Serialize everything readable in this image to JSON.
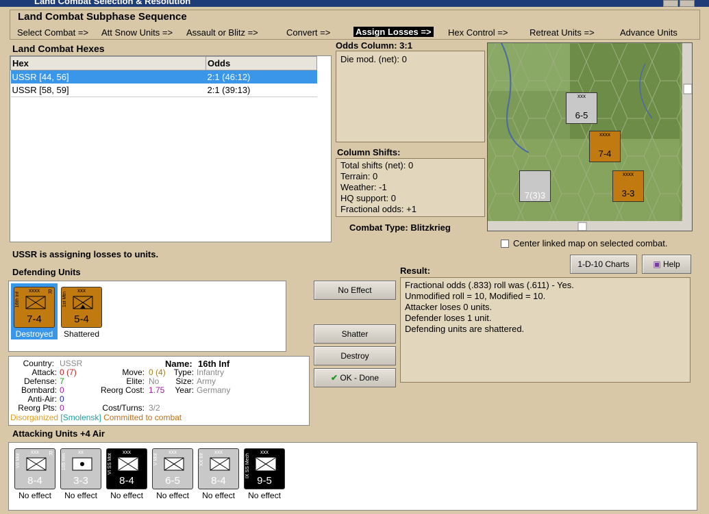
{
  "window": {
    "title": "Land Combat Selection & Resolution"
  },
  "sequence": {
    "title": "Land Combat Subphase Sequence",
    "steps": [
      "Select Combat =>",
      "Att Snow Units =>",
      "Assault or Blitz =>",
      "Convert =>",
      "Assign Losses =>",
      "Hex Control =>",
      "Retreat Units =>",
      "Advance Units"
    ],
    "active_index": 4
  },
  "hexes": {
    "title": "Land Combat Hexes",
    "columns": [
      "Hex",
      "Odds"
    ],
    "rows": [
      {
        "hex": "USSR [44, 56]",
        "odds": "2:1 (46:12)"
      },
      {
        "hex": "USSR [58, 59]",
        "odds": "2:1 (39:13)"
      }
    ],
    "selected_row": 0
  },
  "odds": {
    "title": "Odds Column: 3:1",
    "die_mod": "Die mod. (net): 0"
  },
  "shifts": {
    "title": "Column Shifts:",
    "lines": [
      "Total shifts (net): 0",
      "Terrain: 0",
      "Weather: -1",
      "HQ support: 0",
      "Fractional odds: +1"
    ]
  },
  "combat_type": "Combat Type:  Blitzkrieg",
  "center_map": {
    "label": "Center linked map on selected combat.",
    "checked": false
  },
  "buttons": {
    "charts": "1-D-10 Charts",
    "help": "Help",
    "no_effect": "No Effect",
    "shatter": "Shatter",
    "destroy": "Destroy",
    "ok": "OK - Done"
  },
  "status": "USSR is assigning losses to units.",
  "defending": {
    "title": "Defending Units",
    "units": [
      {
        "side": "16th Inf",
        "size": "xxxx",
        "factors": "7-4",
        "caption": "Destroyed",
        "selected": true,
        "corner": "R"
      },
      {
        "side": "1st Mtn",
        "size": "xxx",
        "factors": "5-4",
        "caption": "Shattered",
        "selected": false,
        "corner": ""
      }
    ]
  },
  "result": {
    "title": "Result:",
    "lines": [
      "Fractional odds (.833) roll was (.611)  - Yes.",
      "Unmodified roll = 10, Modified = 10.",
      "Attacker loses 0 units.",
      "Defender loses 1 unit.",
      "Defending units are shattered."
    ]
  },
  "details": {
    "country_label": "Country:",
    "country": "USSR",
    "attack_label": "Attack:",
    "attack": "0",
    "attack_paren": "(7)",
    "defense_label": "Defense:",
    "defense": "7",
    "bombard_label": "Bombard:",
    "bombard": "0",
    "antiair_label": "Anti-Air:",
    "antiair": "0",
    "reorg_label": "Reorg Pts:",
    "reorg": "0",
    "name_label": "Name:",
    "name": "16th Inf",
    "move_label": "Move:",
    "move": "0",
    "move_paren": "(4)",
    "type_label": "Type:",
    "type": "Infantry",
    "elite_label": "Elite:",
    "elite": "No",
    "size_label": "Size:",
    "size": "Army",
    "reorgcost_label": "Reorg Cost:",
    "reorgcost": "1.75",
    "year_label": "Year:",
    "year": "Germany",
    "costturns_label": "Cost/Turns:",
    "costturns": "3/2",
    "status_disorg": "Disorganized",
    "status_loc": "[Smolensk]",
    "status_commit": "Committed to combat"
  },
  "attacking": {
    "title": "Attacking Units +4 Air",
    "units": [
      {
        "side": "VII Mot",
        "size": "xxx",
        "factors": "8-4",
        "caption": "No effect",
        "style": "grey",
        "corner": "R"
      },
      {
        "side": "105 mm",
        "size": "xx",
        "factors": "3-3",
        "caption": "No effect",
        "style": "grey",
        "corner": ""
      },
      {
        "side": "VI SS Mot",
        "size": "xxx",
        "factors": "8-4",
        "caption": "No effect",
        "style": "black",
        "corner": ""
      },
      {
        "side": "V Mot",
        "size": "xxx",
        "factors": "6-5",
        "caption": "No effect",
        "style": "grey",
        "corner": ""
      },
      {
        "side": "XX Inf",
        "size": "xxx",
        "factors": "8-4",
        "caption": "No effect",
        "style": "grey",
        "corner": ""
      },
      {
        "side": "IX SS Mech",
        "size": "xxx",
        "factors": "9-5",
        "caption": "No effect",
        "style": "black",
        "corner": ""
      }
    ]
  },
  "map": {
    "counters": [
      {
        "label": "6-5",
        "top": "xxx"
      },
      {
        "label": "7-4",
        "top": "xxxx"
      },
      {
        "label": "7(3)3",
        "top": ""
      },
      {
        "label": "3-3",
        "top": "xxxx"
      }
    ]
  }
}
